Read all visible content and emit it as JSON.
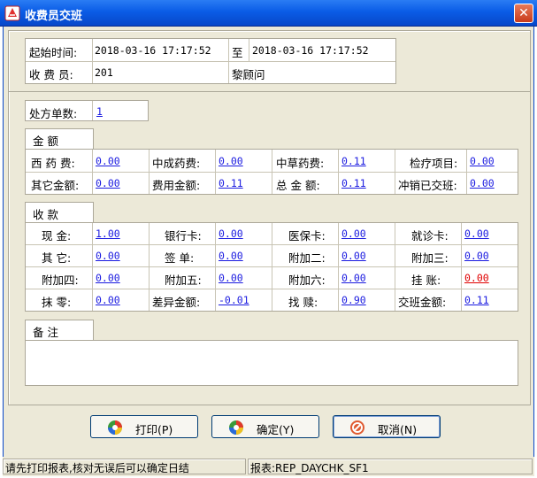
{
  "window": {
    "title": "收费员交班",
    "close_glyph": "✕"
  },
  "header": {
    "start_label": "起始时间:",
    "start_value": "2018-03-16 17:17:52",
    "to_label": "至",
    "end_value": "2018-03-16 17:17:52",
    "cashier_label": "收 费 员:",
    "cashier_id": "201",
    "cashier_name": "黎顾问"
  },
  "prescription": {
    "label": "处方单数:",
    "value": "1"
  },
  "amount": {
    "title": "金  额",
    "rows": [
      [
        {
          "label": "西 药 费:",
          "value": "0.00"
        },
        {
          "label": "中成药费:",
          "value": "0.00"
        },
        {
          "label": "中草药费:",
          "value": "0.11"
        },
        {
          "label": "检疗项目:",
          "value": "0.00"
        }
      ],
      [
        {
          "label": "其它金额:",
          "value": "0.00"
        },
        {
          "label": "费用金额:",
          "value": "0.11"
        },
        {
          "label": "总 金 额:",
          "value": "0.11"
        },
        {
          "label": "冲销已交班:",
          "value": "0.00"
        }
      ]
    ]
  },
  "payment": {
    "title": "收  款",
    "rows": [
      [
        {
          "label": "现  金:",
          "value": "1.00"
        },
        {
          "label": "银行卡:",
          "value": "0.00"
        },
        {
          "label": "医保卡:",
          "value": "0.00"
        },
        {
          "label": "就诊卡:",
          "value": "0.00"
        }
      ],
      [
        {
          "label": "其  它:",
          "value": "0.00"
        },
        {
          "label": "签  单:",
          "value": "0.00"
        },
        {
          "label": "附加二:",
          "value": "0.00"
        },
        {
          "label": "附加三:",
          "value": "0.00"
        }
      ],
      [
        {
          "label": "附加四:",
          "value": "0.00"
        },
        {
          "label": "附加五:",
          "value": "0.00"
        },
        {
          "label": "附加六:",
          "value": "0.00"
        },
        {
          "label": "挂  账:",
          "value": "0.00"
        }
      ],
      [
        {
          "label": "抹  零:",
          "value": "0.00"
        },
        {
          "label": "差异金额:",
          "value": "-0.01"
        },
        {
          "label": "找  赎:",
          "value": "0.90"
        },
        {
          "label": "交班金额:",
          "value": "0.11"
        }
      ]
    ]
  },
  "remarks": {
    "title": "备  注",
    "text": ""
  },
  "buttons": {
    "print": "打印(P)",
    "confirm": "确定(Y)",
    "cancel": "取消(N)"
  },
  "statusbar": {
    "message": "请先打印报表,核对无误后可以确定日结",
    "report": "报表:REP_DAYCHK_SF1"
  },
  "colors": {
    "title_bar": "#0a5ce6",
    "link": "#1a1ae0",
    "negative_hint": "#e00000",
    "dialog_bg": "#ece9d8"
  }
}
